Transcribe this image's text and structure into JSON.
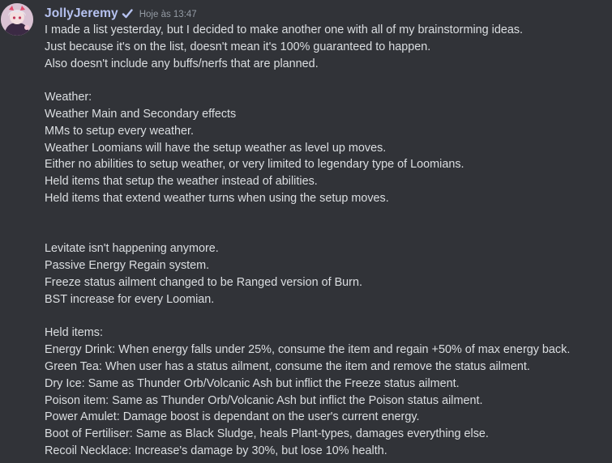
{
  "message": {
    "author": {
      "username": "JollyJeremy",
      "verified_icon": "checkmark-icon",
      "avatar_icon": "avatar-anime-character",
      "username_color": "#b6c2f0"
    },
    "timestamp": "Hoje às 13:47",
    "lines": [
      "I made a list yesterday, but I decided to make another one with all of my brainstorming ideas.",
      "Just because it's on the list, doesn't mean it's 100% guaranteed to happen.",
      "Also doesn't include any buffs/nerfs that are planned.",
      "",
      "Weather:",
      "Weather Main and Secondary effects",
      "MMs to setup every weather.",
      "Weather Loomians will have the setup weather as level up moves.",
      "Either no abilities to setup weather, or very limited to legendary type of Loomians.",
      "Held items that setup the weather instead of abilities.",
      "Held items that extend weather turns when using the setup moves.",
      "",
      "",
      "Levitate isn't happening anymore.",
      "Passive Energy Regain system.",
      "Freeze status ailment changed to be Ranged version of Burn.",
      "BST increase for every Loomian.",
      "",
      "Held items:",
      "Energy Drink: When energy falls under 25%, consume the item and regain +50% of max energy back.",
      "Green Tea: When user has a status ailment, consume the item and remove the status ailment.",
      "Dry Ice: Same as Thunder Orb/Volcanic Ash but inflict the Freeze status ailment.",
      "Poison item: Same as Thunder Orb/Volcanic Ash but inflict the Poison status ailment.",
      "Power Amulet: Damage boost is dependant on the user's current energy.",
      "Boot of Fertiliser: Same as Black Sludge, heals Plant-types, damages everything else.",
      "Recoil Necklace: Increase's damage by 30%, but lose 10% health."
    ]
  },
  "colors": {
    "background": "#313338",
    "text": "#dbdee1",
    "timestamp": "#949ba4"
  }
}
